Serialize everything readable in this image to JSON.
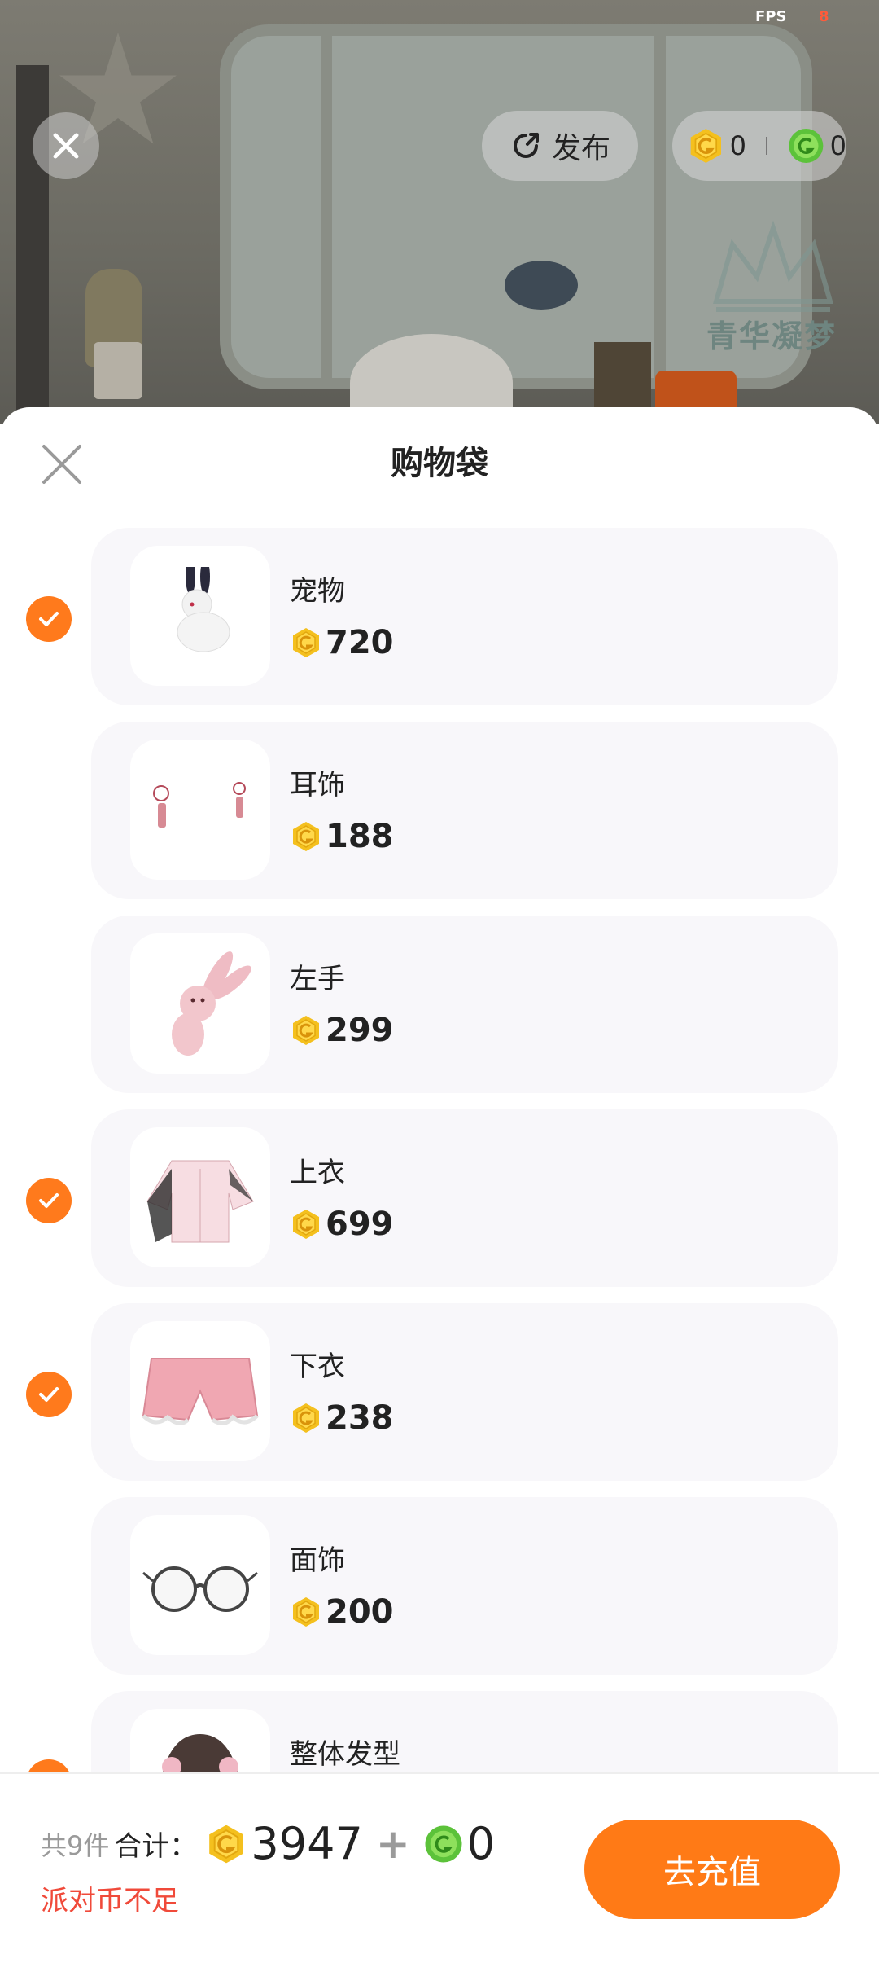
{
  "status": {
    "fps_label": "FPS",
    "fps_value": "8"
  },
  "top": {
    "publish_label": "发布",
    "gold_balance": "0",
    "green_balance": "0",
    "watermark": "青华凝梦"
  },
  "sheet": {
    "title": "购物袋",
    "items": [
      {
        "name": "宠物",
        "price": "720",
        "checked": true
      },
      {
        "name": "耳饰",
        "price": "188",
        "checked": false
      },
      {
        "name": "左手",
        "price": "299",
        "checked": false
      },
      {
        "name": "上衣",
        "price": "699",
        "checked": true
      },
      {
        "name": "下衣",
        "price": "238",
        "checked": true
      },
      {
        "name": "面饰",
        "price": "200",
        "checked": false
      },
      {
        "name": "整体发型",
        "price": "",
        "checked": true
      }
    ]
  },
  "footer": {
    "count_text": "共9件",
    "total_label": "合计：",
    "gold_total": "3947",
    "plus": "+",
    "green_total": "0",
    "warning": "派对币不足",
    "recharge_label": "去充值"
  },
  "colors": {
    "accent": "#ff7a16",
    "gold": "#f4c01e",
    "green": "#5cc23a",
    "warning": "#f04a3a"
  }
}
